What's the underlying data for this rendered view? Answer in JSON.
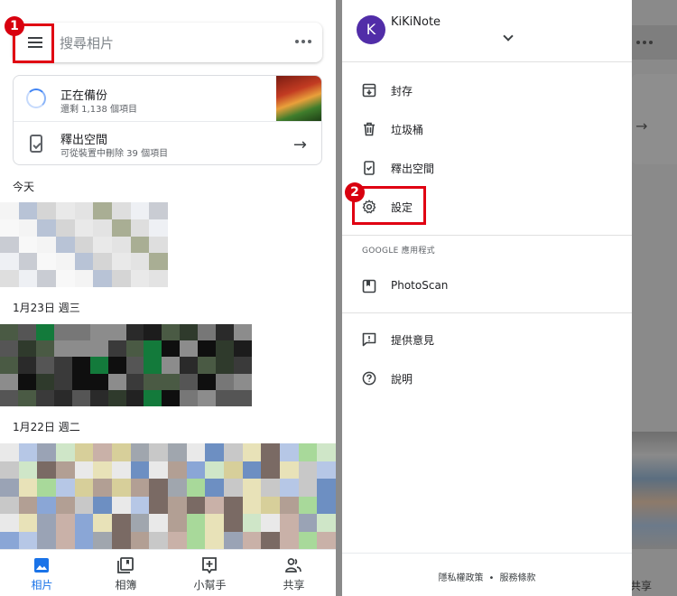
{
  "main": {
    "search": {
      "placeholder": "搜尋相片"
    },
    "backup": {
      "title": "正在備份",
      "subtitle": "還剩 1,138 個項目"
    },
    "free_space": {
      "title": "釋出空間",
      "subtitle": "可從裝置中刪除 39 個項目"
    },
    "dates": [
      "今天",
      "1月23日 週三",
      "1月22日 週二"
    ],
    "bottom_nav": [
      {
        "label": "相片",
        "icon": "photo-icon",
        "active": true
      },
      {
        "label": "相簿",
        "icon": "albums-icon",
        "active": false
      },
      {
        "label": "小幫手",
        "icon": "assistant-icon",
        "active": false
      },
      {
        "label": "共享",
        "icon": "people-icon",
        "active": false
      }
    ],
    "dim_share_partial": "共享"
  },
  "drawer": {
    "account": {
      "initial": "K",
      "name": "KiKiNote"
    },
    "items": [
      {
        "label": "封存",
        "icon": "archive-icon"
      },
      {
        "label": "垃圾桶",
        "icon": "trash-icon"
      },
      {
        "label": "釋出空間",
        "icon": "free-space-icon"
      },
      {
        "label": "設定",
        "icon": "gear-icon"
      }
    ],
    "section_label": "GOOGLE 應用程式",
    "apps": [
      {
        "label": "PhotoScan",
        "icon": "photoscan-icon"
      }
    ],
    "help_items": [
      {
        "label": "提供意見",
        "icon": "feedback-icon"
      },
      {
        "label": "說明",
        "icon": "help-icon"
      }
    ],
    "footer": {
      "privacy": "隱私權政策",
      "separator": "•",
      "terms": "服務條款"
    }
  },
  "annotations": {
    "step1": "1",
    "step2": "2"
  },
  "colors": {
    "accent": "#1a73e8",
    "avatar": "#512da8",
    "annotation_red": "#e00012"
  }
}
